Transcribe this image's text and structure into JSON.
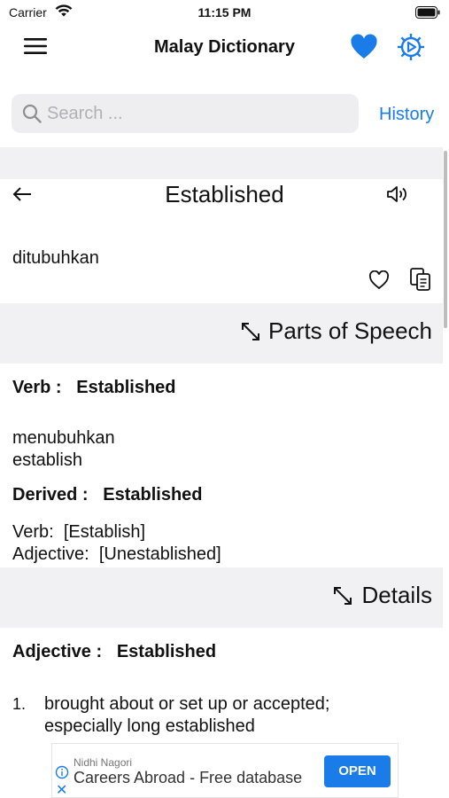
{
  "status_bar": {
    "carrier": "Carrier",
    "time": "11:15 PM"
  },
  "nav": {
    "title": "Malay Dictionary",
    "accent_color": "#1a7ce8"
  },
  "search": {
    "placeholder": "Search ...",
    "value": "",
    "history_label": "History"
  },
  "entry": {
    "word": "Established",
    "translation": "ditubuhkan"
  },
  "parts_of_speech": {
    "section_title": "Parts of Speech",
    "verb_label": "Verb :",
    "verb_word": "Established",
    "verb_meanings": [
      "menubuhkan",
      "establish"
    ],
    "derived_label": "Derived :",
    "derived_word": "Established",
    "derived_lines": [
      {
        "label": "Verb:",
        "value": "[Establish]"
      },
      {
        "label": "Adjective:",
        "value": "[Unestablished]"
      }
    ]
  },
  "details": {
    "section_title": "Details",
    "adjective_label": "Adjective :",
    "adjective_word": "Established",
    "definitions": [
      {
        "number": "1.",
        "text_line1": "brought about or set up or accepted;",
        "text_line2": "especially long established"
      }
    ]
  },
  "ad": {
    "advertiser": "Nidhi Nagori",
    "headline": "Careers Abroad - Free database",
    "cta": "OPEN"
  }
}
